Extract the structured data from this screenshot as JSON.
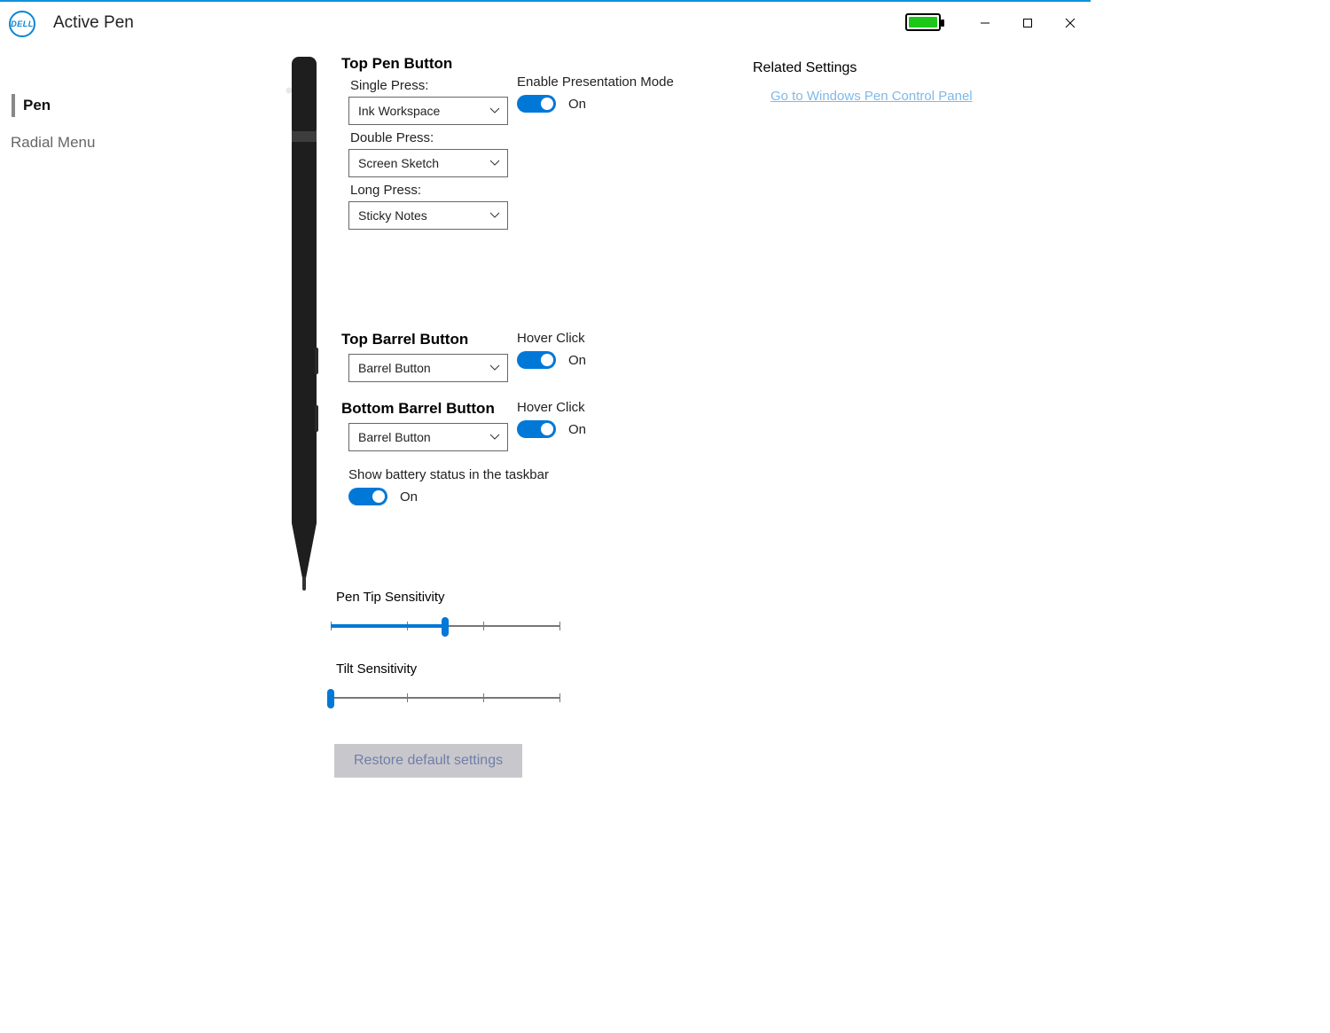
{
  "app_title": "Active Pen",
  "sidebar": {
    "items": [
      {
        "label": "Pen",
        "active": true
      },
      {
        "label": "Radial Menu",
        "active": false
      }
    ]
  },
  "top_pen": {
    "title": "Top Pen Button",
    "single_label": "Single Press:",
    "single_value": "Ink Workspace",
    "double_label": "Double Press:",
    "double_value": "Screen Sketch",
    "long_label": "Long Press:",
    "long_value": "Sticky Notes",
    "presentation_label": "Enable Presentation Mode",
    "presentation_value": "On"
  },
  "top_barrel": {
    "title": "Top Barrel Button",
    "value": "Barrel Button",
    "hover_label": "Hover Click",
    "hover_value": "On"
  },
  "bottom_barrel": {
    "title": "Bottom Barrel Button",
    "value": "Barrel Button",
    "hover_label": "Hover Click",
    "hover_value": "On"
  },
  "battery_status": {
    "label": "Show battery status in the taskbar",
    "value": "On"
  },
  "sliders": {
    "tip_label": "Pen Tip Sensitivity",
    "tip_percent": 50,
    "tilt_label": "Tilt Sensitivity",
    "tilt_percent": 0
  },
  "restore_label": "Restore default settings",
  "related": {
    "title": "Related Settings",
    "link": "Go to Windows Pen Control Panel"
  },
  "colors": {
    "accent": "#0078d7"
  }
}
